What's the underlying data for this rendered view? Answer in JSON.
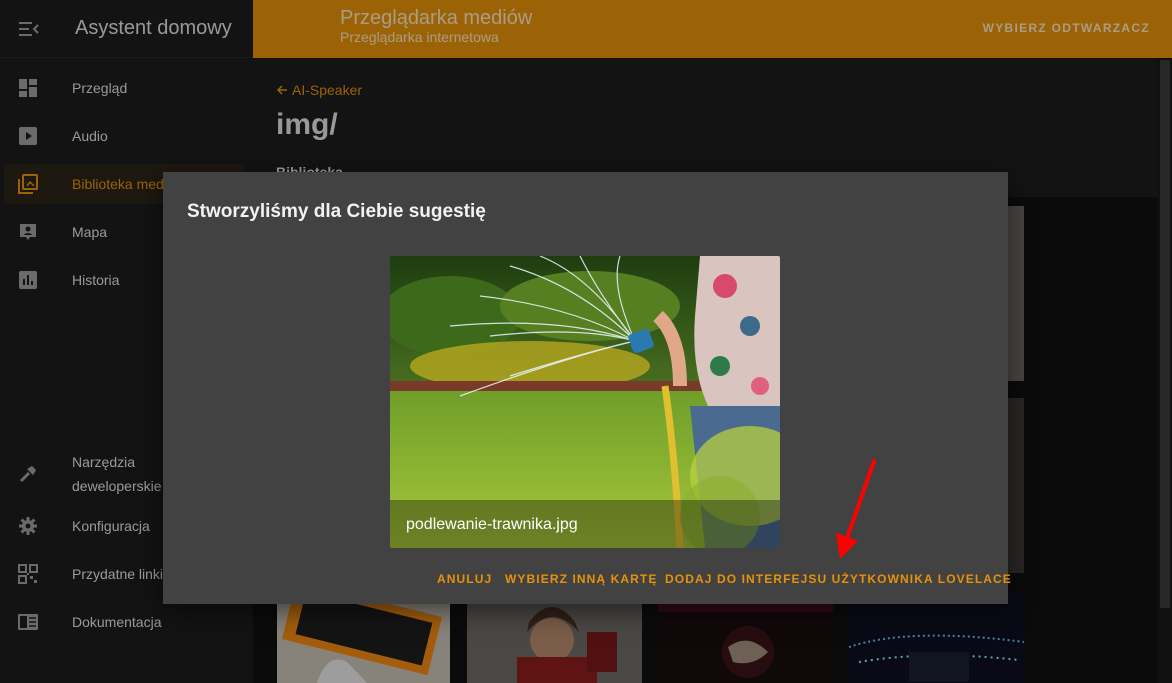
{
  "sidebar": {
    "title": "Asystent domowy",
    "items": [
      {
        "label": "Przegląd",
        "icon": "dashboard-icon"
      },
      {
        "label": "Audio",
        "icon": "play-box-icon"
      },
      {
        "label": "Biblioteka mediów",
        "icon": "media-library-icon"
      },
      {
        "label": "Mapa",
        "icon": "map-account-icon"
      },
      {
        "label": "Historia",
        "icon": "chart-box-icon"
      },
      {
        "label": "Narzędzia deweloperskie",
        "icon": "hammer-icon"
      },
      {
        "label": "Konfiguracja",
        "icon": "gear-icon"
      },
      {
        "label": "Przydatne linki",
        "icon": "qrcode-icon"
      },
      {
        "label": "Dokumentacja",
        "icon": "book-icon"
      }
    ]
  },
  "topbar": {
    "title": "Przeglądarka mediów",
    "subtitle": "Przeglądarka internetowa",
    "action": "WYBIERZ ODTWARZACZ"
  },
  "main": {
    "back_label": "AI-Speaker",
    "folder": "img/",
    "library_label": "Biblioteka"
  },
  "dialog": {
    "title": "Stworzyliśmy dla Ciebie sugestię",
    "caption": "podlewanie-trawnika.jpg",
    "buttons": {
      "cancel": "ANULUJ",
      "other_card": "WYBIERZ INNĄ KARTĘ",
      "add_lovelace": "DODAJ DO INTERFEJSU UŻYTKOWNIKA LOVELACE"
    }
  },
  "colors": {
    "accent": "#e6920a",
    "sidebar_bg": "#1d1d1d",
    "dialog_bg": "#424242",
    "annotation_arrow": "#ff0000"
  }
}
